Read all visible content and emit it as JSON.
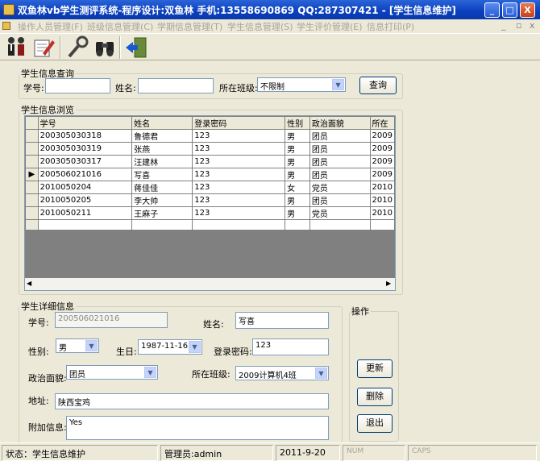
{
  "window": {
    "title": "双鱼林vb学生测评系统-程序设计:双鱼林 手机:13558690869 QQ:287307421 - [学生信息维护]",
    "min": "_",
    "max": "□",
    "close": "X"
  },
  "menu": {
    "items": [
      "操作人员管理(F)",
      "班级信息管理(C)",
      "学期信息管理(T)",
      "学生信息管理(S)",
      "学生评价管理(E)",
      "信息打印(P)"
    ],
    "mdi_min": "_",
    "mdi_restore": "▫",
    "mdi_close": "x"
  },
  "query": {
    "legend": "学生信息查询",
    "sno_label": "学号:",
    "name_label": "姓名:",
    "class_label": "所在班级:",
    "class_value": "不限制",
    "button": "查询"
  },
  "browse": {
    "legend": "学生信息浏览",
    "columns": [
      "学号",
      "姓名",
      "登录密码",
      "性别",
      "政治面貌",
      "所在"
    ],
    "rows": [
      [
        "200305030318",
        "鲁德君",
        "123",
        "男",
        "团员",
        "2009"
      ],
      [
        "200305030319",
        "张燕",
        "123",
        "男",
        "团员",
        "2009"
      ],
      [
        "200305030317",
        "汪建林",
        "123",
        "男",
        "团员",
        "2009"
      ],
      [
        "200506021016",
        "写喜",
        "123",
        "男",
        "团员",
        "2009"
      ],
      [
        "2010050204",
        "蒋佳佳",
        "123",
        "女",
        "党员",
        "2010"
      ],
      [
        "2010050205",
        "李大帅",
        "123",
        "男",
        "团员",
        "2010"
      ],
      [
        "2010050211",
        "王麻子",
        "123",
        "男",
        "党员",
        "2010"
      ]
    ],
    "current_marker": "▶",
    "scroll_left": "◀",
    "scroll_right": "▶"
  },
  "detail": {
    "legend": "学生详细信息",
    "sno_label": "学号:",
    "sno_value": "200506021016",
    "name_label": "姓名:",
    "name_value": "写喜",
    "sex_label": "性别:",
    "sex_value": "男",
    "birth_label": "生日:",
    "birth_value": "1987-11-16",
    "pwd_label": "登录密码:",
    "pwd_value": "123",
    "politics_label": "政治面貌:",
    "politics_value": "团员",
    "class_label": "所在班级:",
    "class_value": "2009计算机4班",
    "addr_label": "地址:",
    "addr_value": "陕西宝鸡",
    "extra_label": "附加信息:",
    "extra_value": "Yes"
  },
  "ops": {
    "legend": "操作",
    "update": "更新",
    "delete": "删除",
    "exit": "退出"
  },
  "status": {
    "state": "状态：学生信息维护",
    "user": "管理员:admin",
    "date": "2011-9-20",
    "num": "NUM",
    "caps": "CAPS"
  }
}
